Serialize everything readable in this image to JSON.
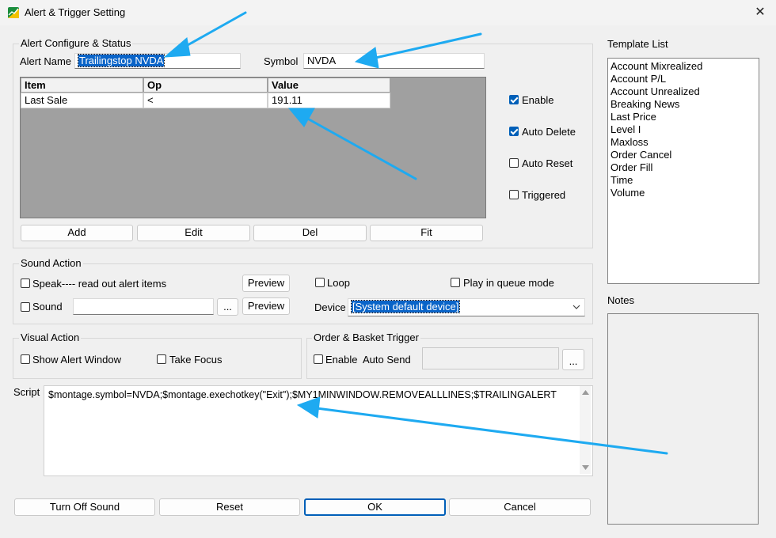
{
  "window": {
    "title": "Alert & Trigger Setting",
    "close_glyph": "✕"
  },
  "alert_configure": {
    "group_label": "Alert Configure & Status",
    "alert_name_label": "Alert Name",
    "alert_name_value": "Trailingstop NVDA",
    "symbol_label": "Symbol",
    "symbol_value": "NVDA",
    "columns": [
      "Item",
      "Op",
      "Value"
    ],
    "rows": [
      [
        "Last Sale",
        "<",
        "191.11"
      ]
    ],
    "buttons": [
      "Add",
      "Edit",
      "Del",
      "Fit"
    ],
    "checkboxes": [
      {
        "label": "Enable",
        "checked": true
      },
      {
        "label": "Auto Delete",
        "checked": true
      },
      {
        "label": "Auto Reset",
        "checked": false
      },
      {
        "label": "Triggered",
        "checked": false
      }
    ]
  },
  "sound_action": {
    "group_label": "Sound Action",
    "speak_label": "Speak---- read out alert items",
    "speak_checked": false,
    "preview_label": "Preview",
    "loop_label": "Loop",
    "loop_checked": false,
    "queue_label": "Play in queue mode",
    "queue_checked": false,
    "sound_label": "Sound",
    "sound_checked": false,
    "sound_value": "",
    "browse_label": "...",
    "device_label": "Device",
    "device_value": "[System default device]"
  },
  "visual_action": {
    "group_label": "Visual Action",
    "show_window_label": "Show Alert Window",
    "take_focus_label": "Take Focus"
  },
  "order_basket": {
    "group_label": "Order & Basket Trigger",
    "enable_label": "Enable",
    "auto_send_label": "Auto Send",
    "auto_send_value": "",
    "browse_label": "..."
  },
  "script": {
    "label": "Script",
    "value": "$montage.symbol=NVDA;$montage.exechotkey(\"Exit\");$MY1MINWINDOW.REMOVEALLLINES;$TRAILINGALERT"
  },
  "bottom_buttons": [
    "Turn Off Sound",
    "Reset",
    "OK",
    "Cancel"
  ],
  "template_list": {
    "label": "Template List",
    "items": [
      "Account Mixrealized",
      "Account P/L",
      "Account Unrealized",
      "Breaking News",
      "Last Price",
      "Level I",
      "Maxloss",
      "Order Cancel",
      "Order Fill",
      "Time",
      "Volume"
    ]
  },
  "notes": {
    "label": "Notes"
  },
  "colors": {
    "annotation_arrow": "#1eaaf1",
    "accent": "#005fb8"
  }
}
